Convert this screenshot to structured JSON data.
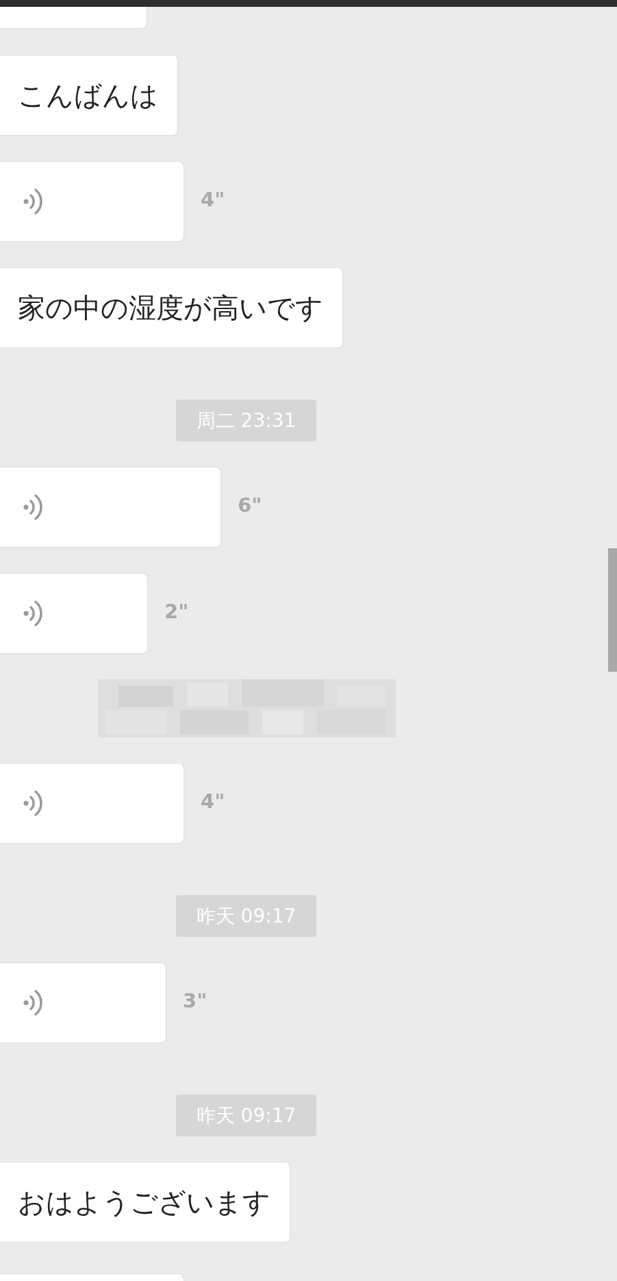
{
  "messages": [
    {
      "kind": "partial"
    },
    {
      "kind": "text",
      "text": "こんばんは"
    },
    {
      "kind": "voice",
      "duration": "4\""
    },
    {
      "kind": "text",
      "text": "家の中の湿度が高いです"
    },
    {
      "kind": "time",
      "text": "周二 23:31"
    },
    {
      "kind": "voice",
      "duration": "6\""
    },
    {
      "kind": "voice",
      "duration": "2\""
    },
    {
      "kind": "redacted"
    },
    {
      "kind": "voice",
      "duration": "4\""
    },
    {
      "kind": "time",
      "text": "昨天 09:17"
    },
    {
      "kind": "voice",
      "duration": "3\""
    },
    {
      "kind": "time",
      "text": "昨天 09:17"
    },
    {
      "kind": "text",
      "text": "おはようございます"
    },
    {
      "kind": "partial"
    }
  ]
}
